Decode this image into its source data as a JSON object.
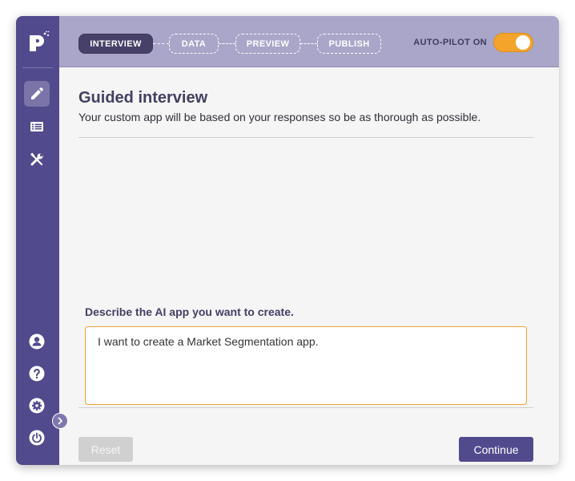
{
  "brand": {
    "logo_letter": "P",
    "sidebar_color": "#514a8d",
    "accent_color": "#f4a42a"
  },
  "sidebar": {
    "top_items": [
      {
        "name": "edit",
        "icon": "pencil-icon",
        "active": true
      },
      {
        "name": "list",
        "icon": "list-icon",
        "active": false
      },
      {
        "name": "tools",
        "icon": "tools-icon",
        "active": false
      }
    ],
    "bottom_items": [
      {
        "name": "account",
        "icon": "user-icon"
      },
      {
        "name": "help",
        "icon": "question-icon"
      },
      {
        "name": "settings",
        "icon": "gear-icon"
      },
      {
        "name": "power",
        "icon": "power-icon"
      }
    ],
    "expand_icon": "chevron-right-icon"
  },
  "header": {
    "steps": [
      {
        "label": "INTERVIEW",
        "active": true
      },
      {
        "label": "DATA",
        "active": false
      },
      {
        "label": "PREVIEW",
        "active": false
      },
      {
        "label": "PUBLISH",
        "active": false
      }
    ],
    "autopilot_label": "AUTO-PILOT ON",
    "autopilot_on": true
  },
  "main": {
    "title": "Guided interview",
    "subtitle": "Your custom app will be based on your responses so be as thorough as possible.",
    "prompt_label": "Describe the AI app you want to create.",
    "prompt_value": "I want to create a Market Segmentation app."
  },
  "actions": {
    "reset_label": "Reset",
    "continue_label": "Continue"
  }
}
